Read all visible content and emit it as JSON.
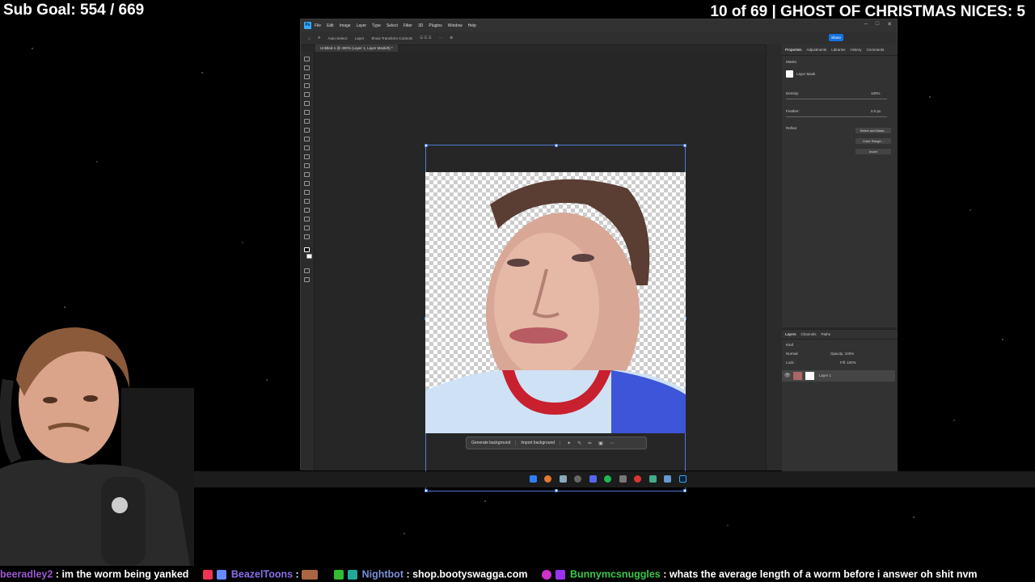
{
  "overlay": {
    "sub_goal": "Sub Goal: 554 / 669",
    "nices": "10 of 69 | GHOST OF CHRISTMAS NICES: 5"
  },
  "photoshop": {
    "menu": [
      "File",
      "Edit",
      "Image",
      "Layer",
      "Type",
      "Select",
      "Filter",
      "3D",
      "Plugins",
      "Window",
      "Help"
    ],
    "options": [
      "Auto-Select:",
      "Layer",
      "Show Transform Controls"
    ],
    "share_label": "Share",
    "doc_tab": "Untitled-1 @ 400% (Layer 1, Layer Mask/8) *",
    "context_bar": {
      "generate_background": "Generate background",
      "import_background": "Import background"
    },
    "properties": {
      "tabs": [
        "Properties",
        "Adjustments",
        "Libraries",
        "History",
        "Comments"
      ],
      "section": "Masks",
      "layer_mask": "Layer Mask",
      "density_label": "Density:",
      "density_value": "100%",
      "feather_label": "Feather:",
      "feather_value": "0.0 px",
      "refine_label": "Refine:",
      "buttons": [
        "Select and Mask...",
        "Color Range...",
        "Invert"
      ]
    },
    "layers": {
      "tabs": [
        "Layers",
        "Channels",
        "Paths"
      ],
      "kind": "Kind",
      "blend_mode": "Normal",
      "opacity": "Opacity: 100%",
      "lock": "Lock:",
      "fill": "Fill: 100%",
      "layer_name": "Layer 1"
    }
  },
  "chat": [
    {
      "user": "beeradley2",
      "user_color": "#9b59d0",
      "message": "im the worm being yanked"
    },
    {
      "user": "BeazelToons",
      "user_color": "#8a6fe8",
      "message": ""
    },
    {
      "user": "Nightbot",
      "user_color": "#7a8fd8",
      "message": "shop.bootyswagga.com"
    },
    {
      "user": "Bunnymcsnuggles",
      "user_color": "#3cc84a",
      "message": "whats the average length of a worm before i answer oh shit nvm"
    }
  ]
}
